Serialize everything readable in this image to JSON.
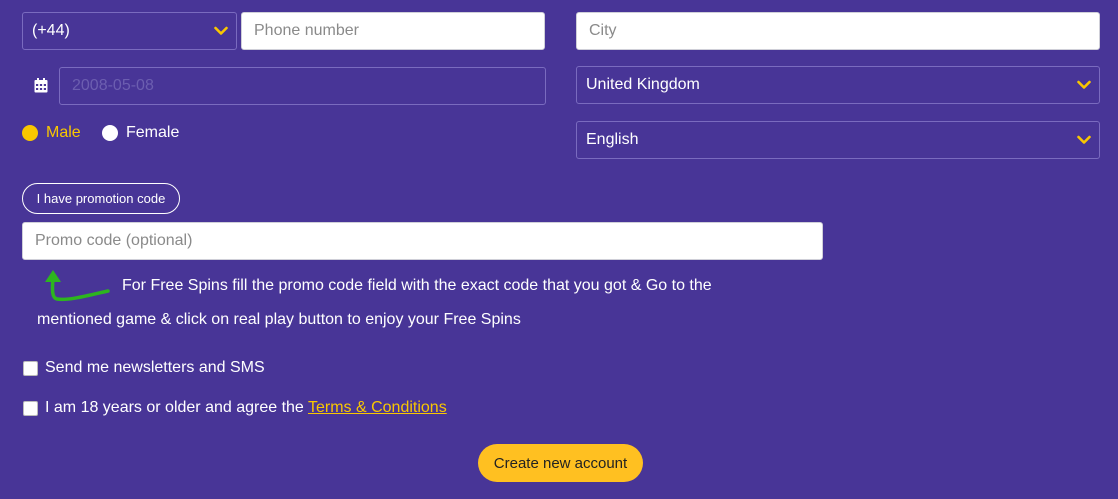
{
  "phone": {
    "country_code": "(+44)",
    "placeholder": "Phone number"
  },
  "city": {
    "placeholder": "City"
  },
  "birthdate": {
    "placeholder": "2008-05-08"
  },
  "country": {
    "selected": "United Kingdom"
  },
  "language": {
    "selected": "English"
  },
  "gender": {
    "male_label": "Male",
    "female_label": "Female",
    "selected": "Male"
  },
  "promo": {
    "toggle_label": "I have promotion code",
    "placeholder": "Promo code (optional)",
    "note_line1": "For Free Spins fill the promo code field with the exact code that you got & Go to the",
    "note_line2": "mentioned game & click on real play button to enjoy your Free Spins"
  },
  "newsletter": {
    "label": "Send me newsletters and SMS",
    "checked": false
  },
  "terms": {
    "label_prefix": "I am 18 years or older and agree the ",
    "link_text": "Terms & Conditions",
    "checked": false
  },
  "submit": {
    "label": "Create new account"
  },
  "colors": {
    "background": "#483597",
    "accent": "#f9c700",
    "button": "#ffc021",
    "arrow": "#2db51f"
  }
}
